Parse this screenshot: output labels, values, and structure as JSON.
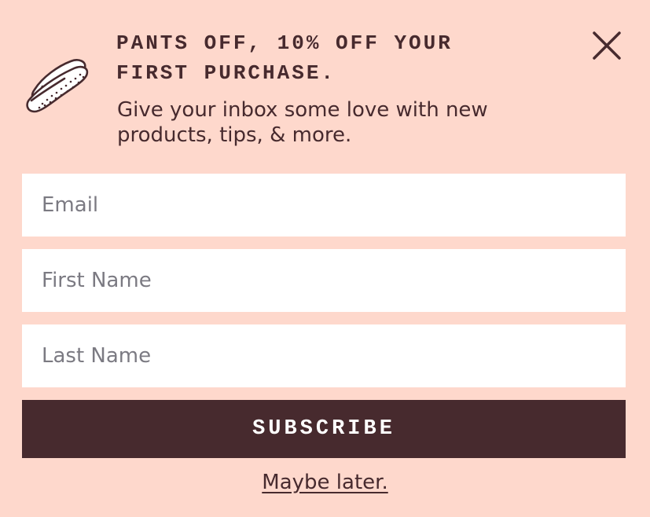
{
  "popup": {
    "icon": "hotdog-icon",
    "headline_line1": "PANTS OFF, 10% OFF YOUR",
    "headline_line2": "FIRST PURCHASE.",
    "subtext_line1": "Give your inbox some love with new",
    "subtext_line2": "products, tips, & more.",
    "close_icon": "close-icon"
  },
  "form": {
    "email": {
      "value": "",
      "placeholder": "Email"
    },
    "first_name": {
      "value": "",
      "placeholder": "First Name"
    },
    "last_name": {
      "value": "",
      "placeholder": "Last Name"
    },
    "subscribe_label": "SUBSCRIBE",
    "dismiss_label": "Maybe later."
  },
  "colors": {
    "background": "#fed8cc",
    "text": "#472a2e",
    "button": "#472a2e",
    "button_text": "#ffffff",
    "input_background": "#ffffff",
    "placeholder": "#7b7a82"
  }
}
